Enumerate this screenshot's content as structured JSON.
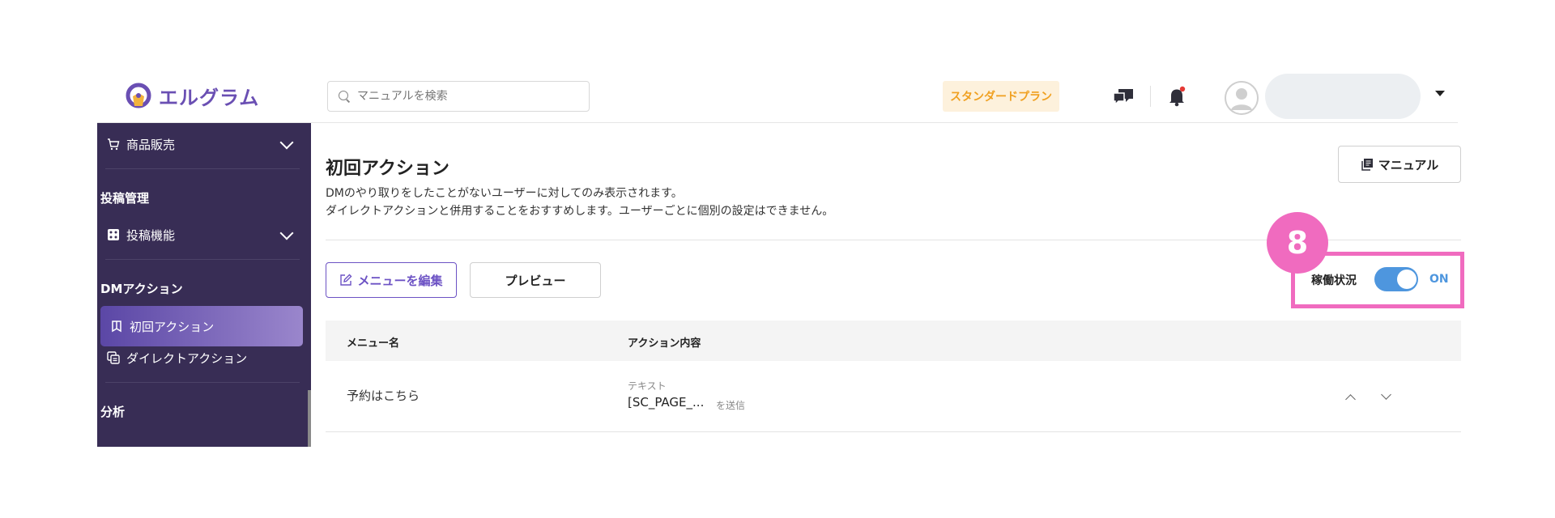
{
  "header": {
    "logo_text": "エルグラム",
    "search_placeholder": "マニュアルを検索",
    "plan_label": "スタンダードプラン",
    "icons": {
      "chat": "chat-icon",
      "bell": "bell-icon",
      "avatar": "user-avatar-icon"
    },
    "accent_color": "#6a4fb3",
    "plan_color": "#f0a020"
  },
  "sidebar": {
    "background": "#382d55",
    "items": [
      {
        "label": "商品販売",
        "icon": "cart-icon",
        "expandable": true
      },
      {
        "heading": "投稿管理"
      },
      {
        "label": "投稿機能",
        "icon": "dice-icon",
        "expandable": true
      },
      {
        "heading": "DMアクション"
      },
      {
        "label": "初回アクション",
        "icon": "bookmark-icon",
        "active": true
      },
      {
        "label": "ダイレクトアクション",
        "icon": "copy-icon"
      },
      {
        "heading": "分析"
      }
    ]
  },
  "main": {
    "title": "初回アクション",
    "description_line1": "DMのやり取りをしたことがないユーザーに対してのみ表示されます。",
    "description_line2": "ダイレクトアクションと併用することをおすすめします。ユーザーごとに個別の設定はできません。",
    "manual_button": "マニュアル",
    "edit_button": "メニューを編集",
    "preview_button": "プレビュー",
    "status": {
      "label": "稼働状況",
      "toggle_state": "ON",
      "enabled": true,
      "toggle_color": "#4e96de"
    },
    "step_badge": "8",
    "highlight_color": "#f06bbf",
    "table": {
      "columns": [
        "メニュー名",
        "アクション内容"
      ],
      "rows": [
        {
          "name": "予約はこちら",
          "type": "テキスト",
          "value": "[SC_PAGE_...",
          "suffix": "を送信"
        }
      ]
    }
  }
}
